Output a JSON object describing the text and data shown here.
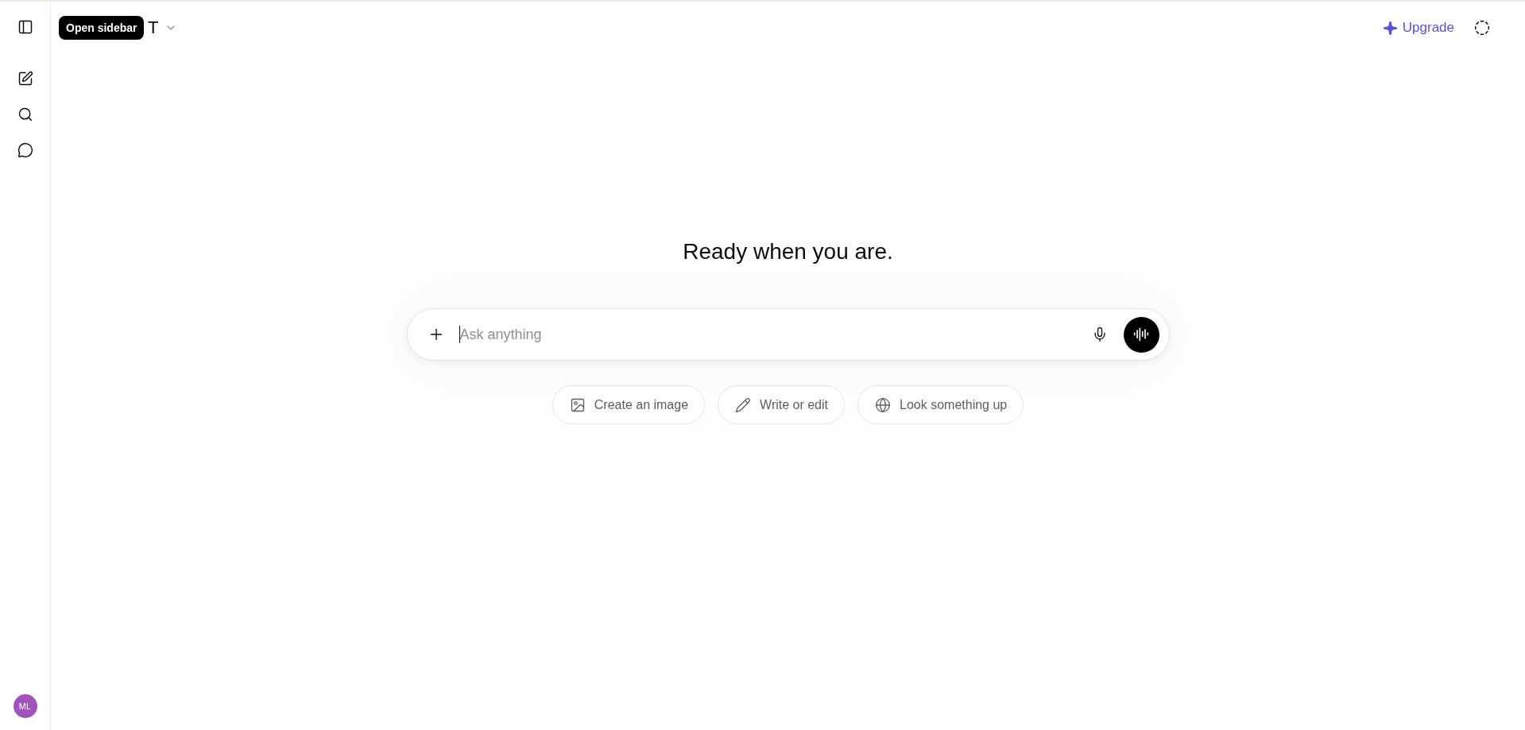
{
  "tooltip": {
    "text": "Open sidebar"
  },
  "header": {
    "model_title": "T",
    "upgrade": "Upgrade"
  },
  "headline": "Ready when you are.",
  "composer": {
    "placeholder": "Ask anything"
  },
  "suggestions": [
    {
      "kind": "image",
      "label": "Create an image"
    },
    {
      "kind": "write",
      "label": "Write or edit"
    },
    {
      "kind": "web",
      "label": "Look something up"
    }
  ],
  "account": {
    "initials": "ML"
  }
}
